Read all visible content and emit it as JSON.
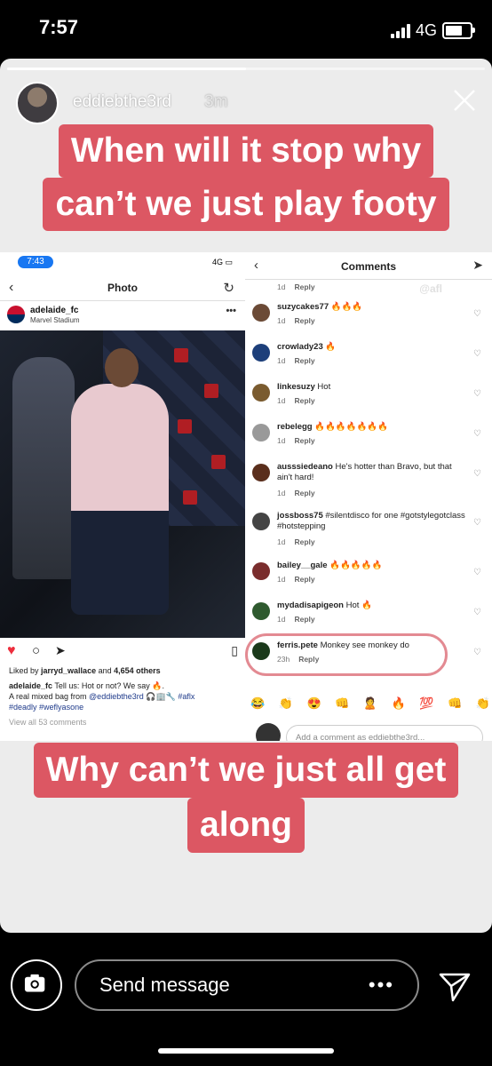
{
  "status_bar": {
    "time": "7:57",
    "network": "4G"
  },
  "story": {
    "username": "eddiebthe3rd",
    "time_ago": "3m",
    "progress": 0.5,
    "caption_top_line1": "When will it stop why",
    "caption_top_line2": "can’t we just play footy",
    "caption_bottom_line1": "Why can’t we just all get",
    "caption_bottom_line2": "along"
  },
  "left_screenshot": {
    "time": "7:43",
    "network": "4G",
    "nav_title": "Photo",
    "account": "adelaide_fc",
    "location": "Marvel Stadium",
    "likes_prefix": "Liked by ",
    "likes_user": "jarryd_wallace",
    "likes_suffix": " and ",
    "likes_count": "4,654 others",
    "caption_user": "adelaide_fc",
    "caption_text1": " Tell us: Hot or not? We say 🔥.",
    "caption_text2": "A real mixed bag from ",
    "caption_mention": "@eddiebthe3rd",
    "caption_text3": " 🎧🏢🔧 ",
    "caption_tag1": "#aflx",
    "caption_tag2": "#deadly",
    "caption_tag3": "#weflyasone",
    "view_comments": "View all 53 comments"
  },
  "right_screenshot": {
    "nav_title": "Comments",
    "watermark": "@afl",
    "top_meta": {
      "time": "1d",
      "reply": "Reply"
    },
    "comments": [
      {
        "user": "suzycakes77",
        "text": " 🔥🔥🔥",
        "time": "1d",
        "reply": "Reply",
        "color": "#6b4a36"
      },
      {
        "user": "crowlady23",
        "text": " 🔥",
        "time": "1d",
        "reply": "Reply",
        "color": "#1d3f7a"
      },
      {
        "user": "linkesuzy",
        "text": " Hot",
        "time": "1d",
        "reply": "Reply",
        "color": "#7a5b2f"
      },
      {
        "user": "rebelegg",
        "text": " 🔥🔥🔥🔥🔥🔥🔥",
        "time": "1d",
        "reply": "Reply",
        "color": "#999999"
      },
      {
        "user": "ausssiedeano",
        "text": " He's hotter than Bravo, but that ain't hard!",
        "time": "1d",
        "reply": "Reply",
        "color": "#5a2e1c"
      },
      {
        "user": "jossboss75",
        "text": " #silentdisco for one #gotstylegotclass #hotstepping",
        "time": "1d",
        "reply": "Reply",
        "color": "#444444"
      },
      {
        "user": "bailey__gale",
        "text": " 🔥🔥🔥🔥🔥",
        "time": "1d",
        "reply": "Reply",
        "color": "#7a2d2d"
      },
      {
        "user": "mydadisapigeon",
        "text": " Hot 🔥",
        "time": "1d",
        "reply": "Reply",
        "color": "#2f5a2f"
      },
      {
        "user": "ferris.pete",
        "text": " Monkey see monkey do",
        "time": "23h",
        "reply": "Reply",
        "color": "#1b3a1b"
      }
    ],
    "emojis": [
      "😂",
      "👏",
      "😍",
      "👊",
      "🙎",
      "🔥",
      "💯",
      "👊",
      "👏"
    ],
    "input_placeholder": "Add a comment as eddiebthe3rd..."
  },
  "bottom_bar": {
    "send_message": "Send message",
    "more": "•••"
  }
}
